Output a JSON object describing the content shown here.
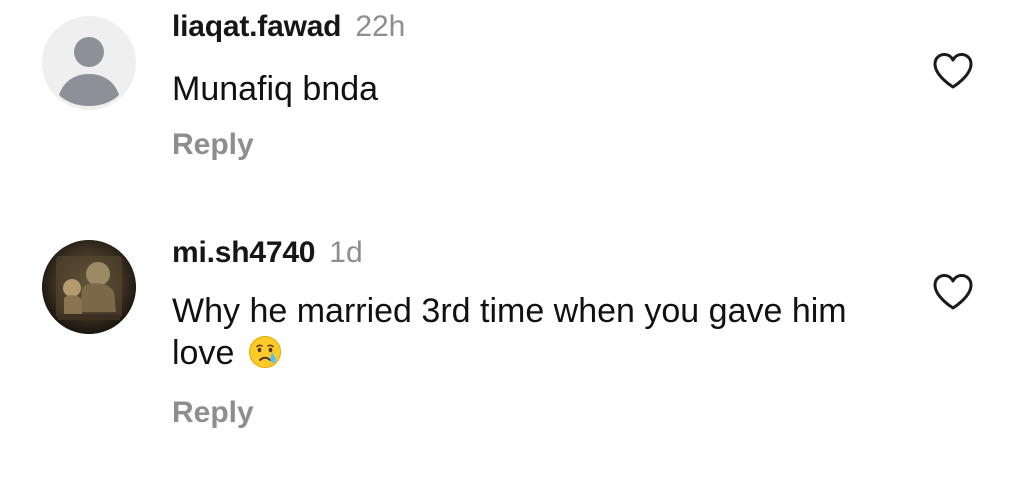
{
  "comments": [
    {
      "username": "liaqat.fawad",
      "time": "22h",
      "text": "Munafiq bnda",
      "reply_label": "Reply",
      "like_icon": "heart-outline-icon",
      "avatar": "default-avatar"
    },
    {
      "username": "mi.sh4740",
      "time": "1d",
      "text": "Why he married 3rd time when you gave him love",
      "emoji": "crying-face-emoji",
      "reply_label": "Reply",
      "like_icon": "heart-outline-icon",
      "avatar": "photo-avatar"
    }
  ],
  "colors": {
    "text": "#111111",
    "muted": "#8e8e8e",
    "background": "#ffffff"
  }
}
